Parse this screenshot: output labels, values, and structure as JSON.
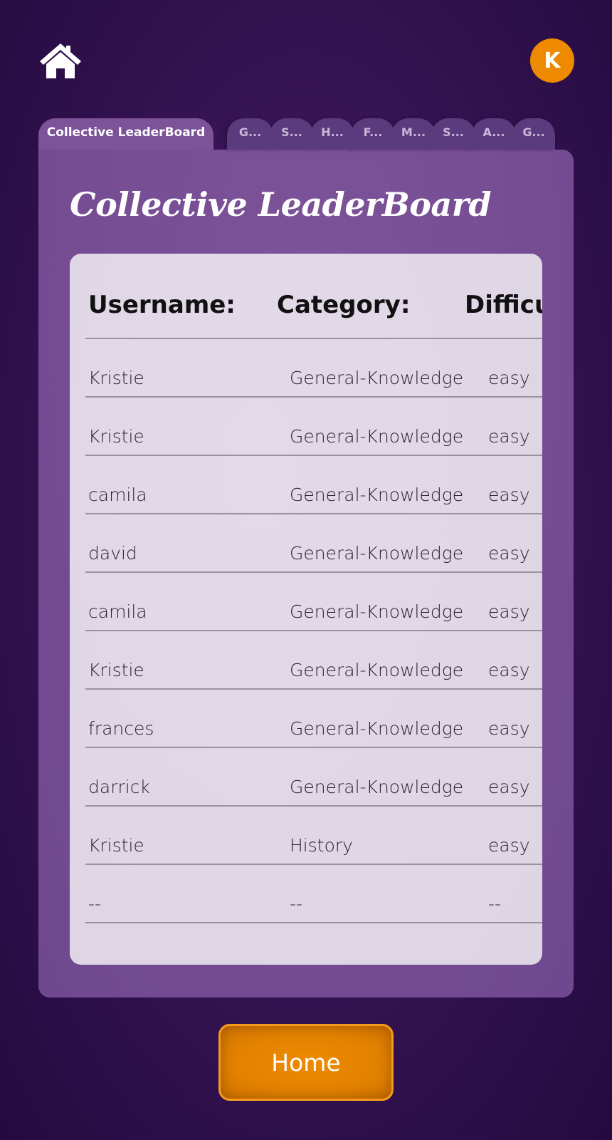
{
  "header": {
    "home_icon": "home-icon",
    "avatar_initial": "K"
  },
  "tabs": [
    {
      "label": "Collective LeaderBoard",
      "active": true
    },
    {
      "label": "G...",
      "active": false
    },
    {
      "label": "S...",
      "active": false
    },
    {
      "label": "H...",
      "active": false
    },
    {
      "label": "F...",
      "active": false
    },
    {
      "label": "M...",
      "active": false
    },
    {
      "label": "S...",
      "active": false
    },
    {
      "label": "A...",
      "active": false
    },
    {
      "label": "G...",
      "active": false
    }
  ],
  "panel": {
    "title": "Collective LeaderBoard"
  },
  "table": {
    "headers": [
      "Username:",
      "Category:",
      "Difficu"
    ],
    "rows": [
      [
        "Kristie",
        "General-Knowledge",
        "easy"
      ],
      [
        "Kristie",
        "General-Knowledge",
        "easy"
      ],
      [
        "camila",
        "General-Knowledge",
        "easy"
      ],
      [
        "david",
        "General-Knowledge",
        "easy"
      ],
      [
        "camila",
        "General-Knowledge",
        "easy"
      ],
      [
        "Kristie",
        "General-Knowledge",
        "easy"
      ],
      [
        "frances",
        "General-Knowledge",
        "easy"
      ],
      [
        "darrick",
        "General-Knowledge",
        "easy"
      ],
      [
        "Kristie",
        "History",
        "easy"
      ],
      [
        "--",
        "--",
        "--"
      ]
    ]
  },
  "footer": {
    "home_button_label": "Home"
  },
  "colors": {
    "background": "#2a0d47",
    "panel": "#7c5299",
    "tab_inactive": "#5c3a7e",
    "table_card": "#e2d8e8",
    "accent_orange": "#ee8a00",
    "divider": "#9a929e"
  }
}
